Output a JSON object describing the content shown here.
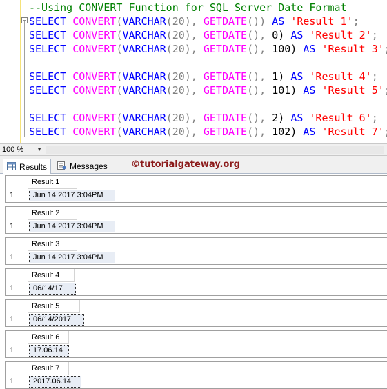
{
  "editor": {
    "comment": "--Using CONVERT Function for SQL Server Date Format",
    "lines": [
      {
        "kw1": "SELECT",
        "fn1": "CONVERT",
        "p1": "(",
        "kw2": "VARCHAR",
        "p2": "(20),",
        "fn2": "GETDATE",
        "p3": "())",
        "style": "",
        "kw3": "AS",
        "str": "'Result 1'",
        "end": ";"
      },
      {
        "kw1": "SELECT",
        "fn1": "CONVERT",
        "p1": "(",
        "kw2": "VARCHAR",
        "p2": "(20),",
        "fn2": "GETDATE",
        "p3": "(),",
        "style": "0)",
        "kw3": "AS",
        "str": "'Result 2'",
        "end": ";"
      },
      {
        "kw1": "SELECT",
        "fn1": "CONVERT",
        "p1": "(",
        "kw2": "VARCHAR",
        "p2": "(20),",
        "fn2": "GETDATE",
        "p3": "(),",
        "style": "100)",
        "kw3": "AS",
        "str": "'Result 3'",
        "end": ";"
      },
      {
        "kw1": "SELECT",
        "fn1": "CONVERT",
        "p1": "(",
        "kw2": "VARCHAR",
        "p2": "(20),",
        "fn2": "GETDATE",
        "p3": "(),",
        "style": "1)",
        "kw3": "AS",
        "str": "'Result 4'",
        "end": ";"
      },
      {
        "kw1": "SELECT",
        "fn1": "CONVERT",
        "p1": "(",
        "kw2": "VARCHAR",
        "p2": "(20),",
        "fn2": "GETDATE",
        "p3": "(),",
        "style": "101)",
        "kw3": "AS",
        "str": "'Result 5'",
        "end": ";"
      },
      {
        "kw1": "SELECT",
        "fn1": "CONVERT",
        "p1": "(",
        "kw2": "VARCHAR",
        "p2": "(20),",
        "fn2": "GETDATE",
        "p3": "(),",
        "style": "2)",
        "kw3": "AS",
        "str": "'Result 6'",
        "end": ";"
      },
      {
        "kw1": "SELECT",
        "fn1": "CONVERT",
        "p1": "(",
        "kw2": "VARCHAR",
        "p2": "(20),",
        "fn2": "GETDATE",
        "p3": "(),",
        "style": "102)",
        "kw3": "AS",
        "str": "'Result 7'",
        "end": ";"
      }
    ]
  },
  "zoom": {
    "value": "100 %"
  },
  "tabs": {
    "results": "Results",
    "messages": "Messages"
  },
  "watermark": "©tutorialgateway.org",
  "results": [
    {
      "column": "Result 1",
      "row": "1",
      "value": "Jun 14 2017  3:04PM"
    },
    {
      "column": "Result 2",
      "row": "1",
      "value": "Jun 14 2017  3:04PM"
    },
    {
      "column": "Result 3",
      "row": "1",
      "value": "Jun 14 2017  3:04PM"
    },
    {
      "column": "Result 4",
      "row": "1",
      "value": "06/14/17"
    },
    {
      "column": "Result 5",
      "row": "1",
      "value": "06/14/2017"
    },
    {
      "column": "Result 6",
      "row": "1",
      "value": "17.06.14"
    },
    {
      "column": "Result 7",
      "row": "1",
      "value": "2017.06.14"
    }
  ],
  "colors": {
    "keyword": "#0000ff",
    "function": "#ff00ff",
    "string": "#ff0000",
    "comment": "#008000",
    "watermark": "#8b1a1a"
  },
  "icons": {
    "results_tab": "grid-icon",
    "messages_tab": "messages-icon",
    "fold": "collapse-icon"
  }
}
